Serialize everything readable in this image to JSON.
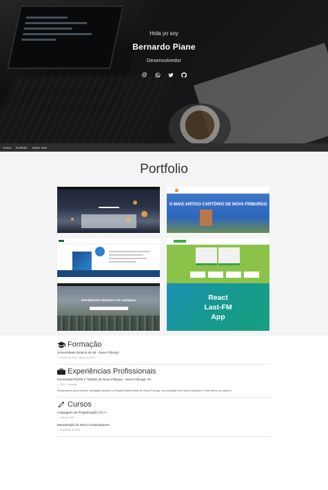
{
  "hero": {
    "greeting": "Hola yo soy",
    "name": "Bernardo Piane",
    "role": "Desenvolvedor",
    "socials": [
      {
        "name": "email-icon",
        "glyph": "@"
      },
      {
        "name": "whatsapp-icon"
      },
      {
        "name": "twitter-icon"
      },
      {
        "name": "github-icon"
      }
    ]
  },
  "nav": {
    "items": [
      "Home",
      "Portfolio",
      "Sobre mim"
    ]
  },
  "portfolio": {
    "title": "Portfolio",
    "items": [
      {
        "label": "Project screenshot 1"
      },
      {
        "caption": "O MAIS ANTIGO CARTÓRIO DE NOVA FRIBURGO"
      },
      {
        "label": "SOLUÇÕES EFICIENTES PARA EMPRESAS INTELIGENTES"
      },
      {
        "label": "Project screenshot 4"
      },
      {
        "caption": "Atendimento eficiente e de confiança"
      },
      {
        "caption_lines": [
          "React",
          "Last-FM",
          "App"
        ]
      }
    ]
  },
  "sections": {
    "formacao": {
      "title": "Formação",
      "entries": [
        {
          "title": "Universidade Estácio de Sá - Nova Friburgo",
          "meta": "— Janeiro de 2015 - Março de 2018"
        }
      ]
    },
    "experiencias": {
      "title": "Experiências Profissionais",
      "entries": [
        {
          "title": "Escrevente RCPN 1º Distrito de Nova Friburgo - Nova Friburgo, RJ",
          "meta": "— 2014 - Presente",
          "desc": "Responsável pela unidade interligada situada no Hospital Maternidade de Nova Friburgo, comunicação com outros cartórios e rede interna do cartório."
        }
      ]
    },
    "cursos": {
      "title": "Cursos",
      "entries": [
        {
          "title": "Linguagem de Programação C/C++",
          "meta": "— Julho de 2011"
        },
        {
          "title": "Manutenção de Micro-Computadores",
          "meta": "— Novembro de 2009"
        }
      ]
    }
  }
}
